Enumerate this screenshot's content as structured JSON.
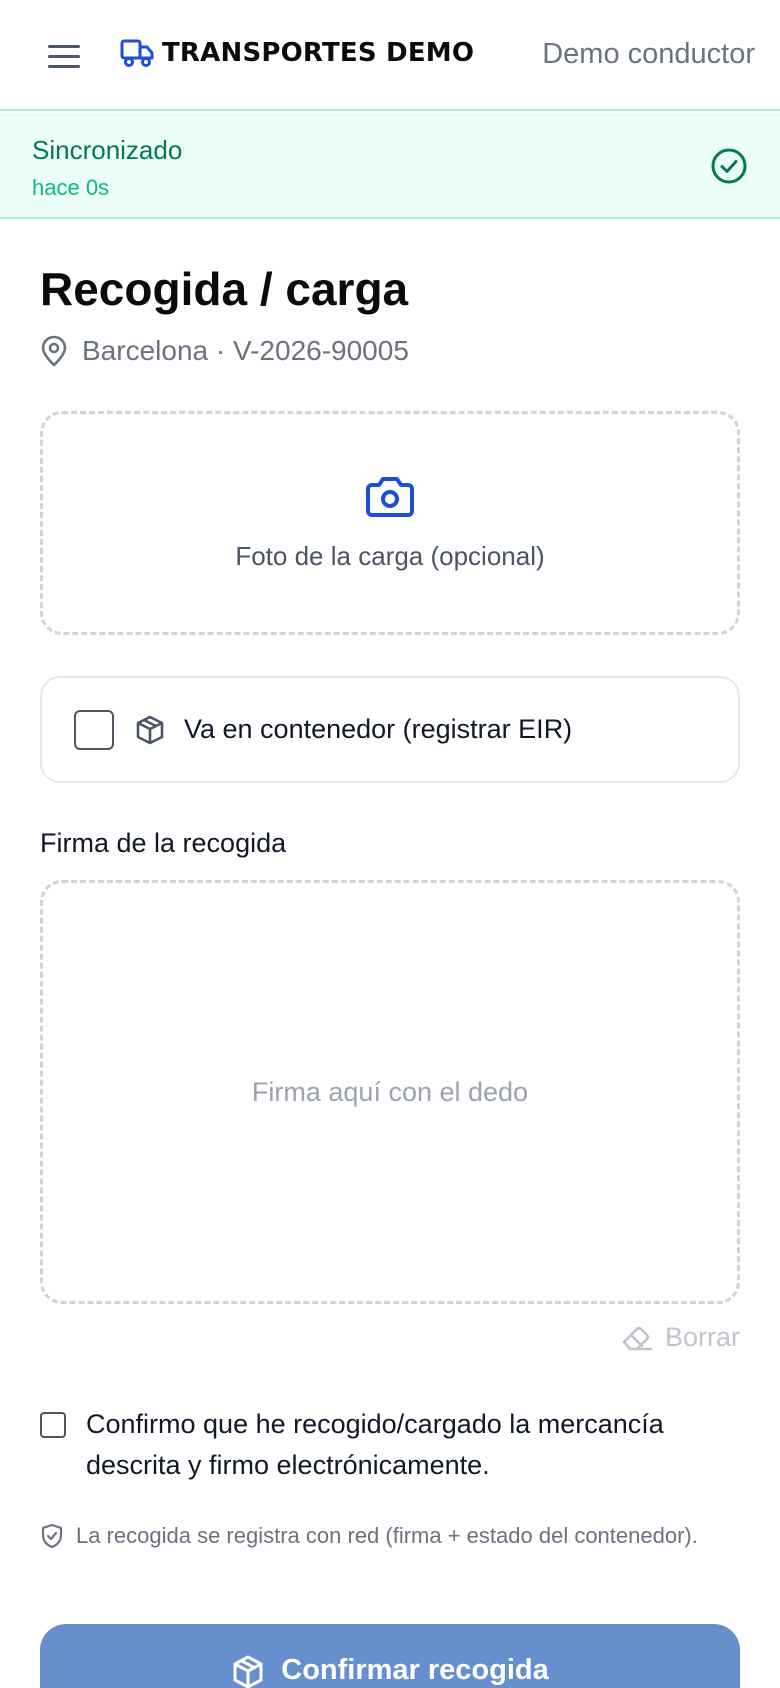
{
  "header": {
    "brand": "TRANSPORTES DEMO",
    "user": "Demo conductor",
    "icons": {
      "menu": "menu-icon",
      "truck": "truck-icon"
    }
  },
  "sync": {
    "title": "Sincronizado",
    "subtitle": "hace 0s",
    "icon": "check-circle-icon"
  },
  "page": {
    "title": "Recogida / carga",
    "location": "Barcelona · V-2026-90005"
  },
  "photo": {
    "label": "Foto de la carga (opcional)",
    "icon": "camera-icon"
  },
  "container": {
    "label": "Va en contenedor (registrar EIR)",
    "checked": false,
    "icon": "box-icon"
  },
  "signature": {
    "label": "Firma de la recogida",
    "placeholder": "Firma aquí con el dedo",
    "clear_label": "Borrar"
  },
  "confirm": {
    "text": "Confirmo que he recogido/cargado la mercancía descrita y firmo electrónicamente.",
    "checked": false
  },
  "note": {
    "text": "La recogida se registra con red (firma + estado del contenedor).",
    "icon": "shield-check-icon"
  },
  "submit": {
    "label": "Confirmar recogida",
    "icon": "package-icon"
  },
  "colors": {
    "brand_blue": "#1d4ed8",
    "sync_green": "#047857",
    "sync_bg": "#ecfdf5",
    "button_bg": "#6690cd"
  }
}
